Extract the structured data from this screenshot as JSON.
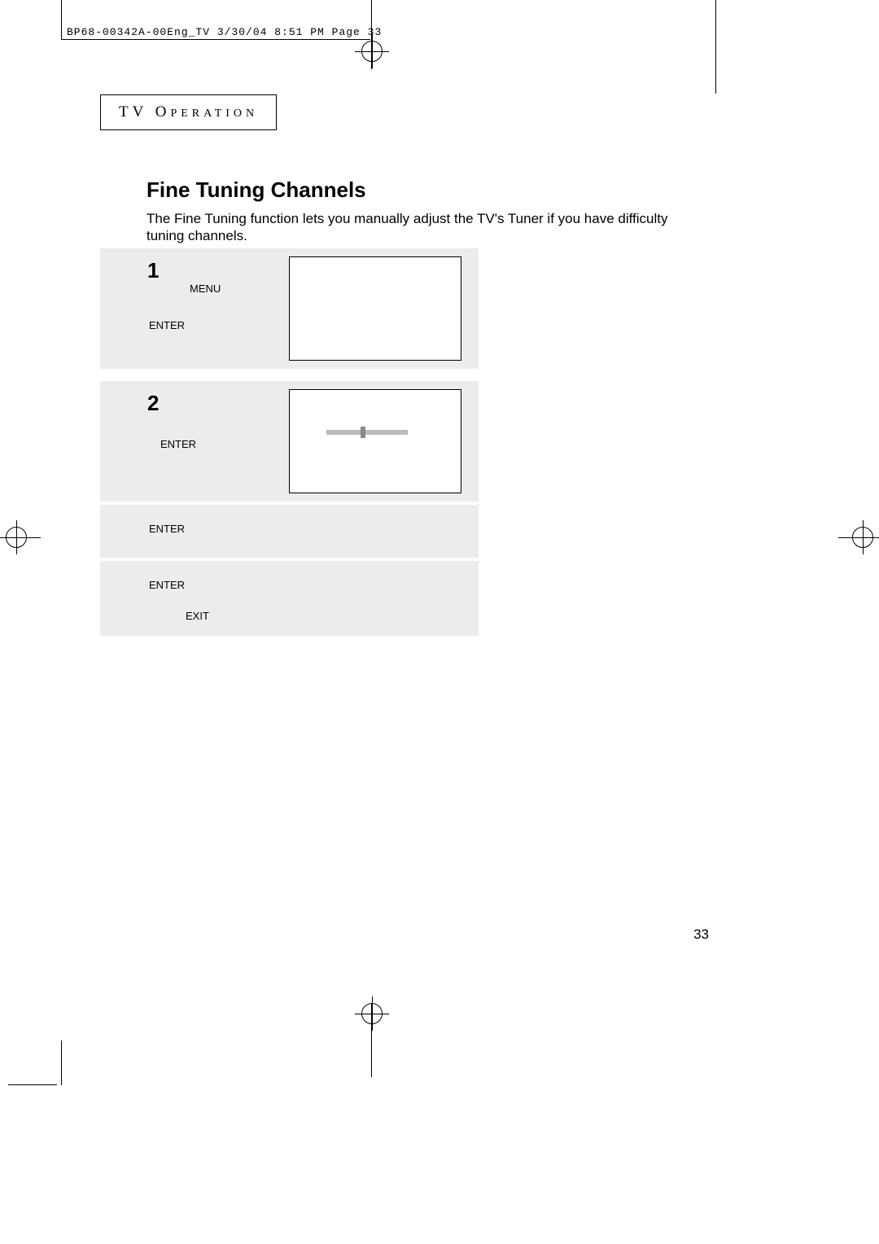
{
  "header_line": "BP68-00342A-00Eng_TV  3/30/04  8:51 PM  Page 33",
  "section": {
    "tv": "TV",
    "op_first": "O",
    "op_rest": "PERATION"
  },
  "title": "Fine Tuning Channels",
  "description": "The Fine Tuning function lets you manually adjust the TV's Tuner if you have difficulty tuning channels.",
  "steps": {
    "one": {
      "num": "1",
      "menu": "MENU",
      "enter": "ENTER"
    },
    "two": {
      "num": "2",
      "enter_a": "ENTER",
      "enter_b": "ENTER",
      "enter_c": "ENTER",
      "exit": "EXIT"
    }
  },
  "page_number": "33"
}
